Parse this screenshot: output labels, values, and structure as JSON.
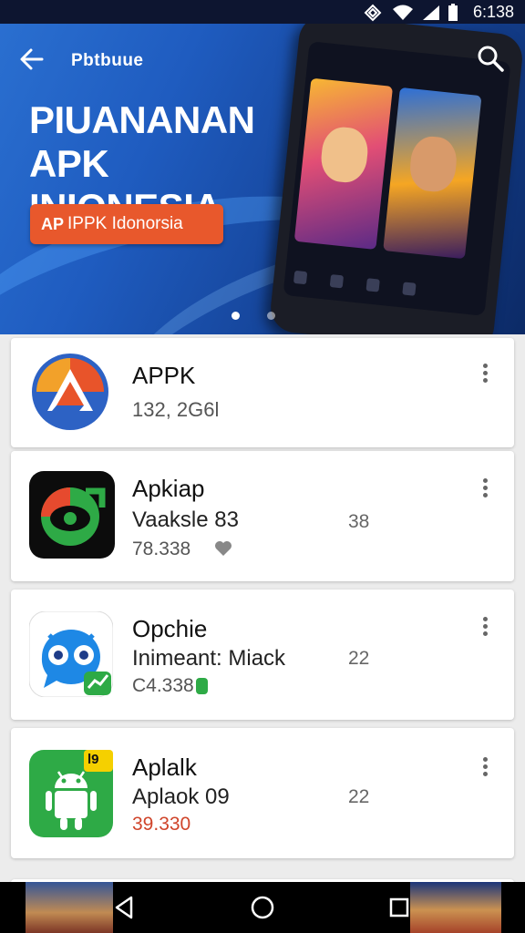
{
  "status_bar": {
    "time": "6:138"
  },
  "hero": {
    "brand": "Pbtbuue",
    "title_line1": "PIUANANAN",
    "title_line2": "APK INIONESIA",
    "cta_label": "IPPK Idonorsia",
    "cta_icon": "AP"
  },
  "apps": [
    {
      "name": "APPK",
      "line2": "",
      "line3": "132, 2G6l",
      "count": "",
      "icon": "triangle-logo-icon"
    },
    {
      "name": "Apkiap",
      "line2": "Vaaksle 83",
      "line3": "78.338",
      "count": "38",
      "icon": "green-eye-icon"
    },
    {
      "name": "Opchie",
      "line2": "Inimeant: Miack",
      "line3": "C4.338",
      "count": "22",
      "icon": "blue-owl-icon"
    },
    {
      "name": "Aplalk",
      "line2": "Aplaok 09",
      "line3": "39.330",
      "count": "22",
      "icon": "android-robot-icon",
      "badge": "l9"
    }
  ],
  "colors": {
    "hero_blue": "#1f5cc0",
    "cta_orange": "#e8582c",
    "price_red": "#d0452b",
    "accent_green": "#2eaa46"
  }
}
